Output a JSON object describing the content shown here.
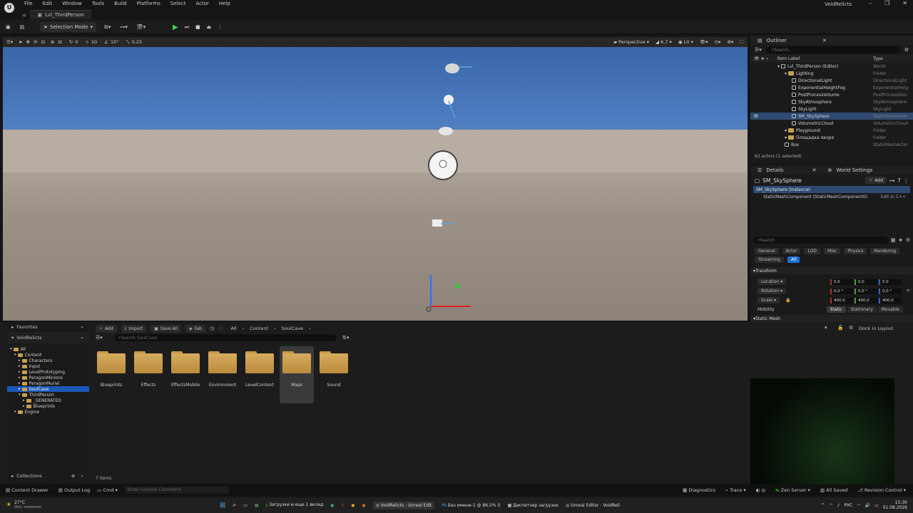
{
  "menubar": {
    "items": [
      "File",
      "Edit",
      "Window",
      "Tools",
      "Build",
      "Platforms",
      "Select",
      "Actor",
      "Help"
    ],
    "level_tab": "Lvl_ThirdPerson",
    "project": "VoidRelicts"
  },
  "toolbar": {
    "mode": "Selection Mode"
  },
  "viewport": {
    "perspective": "Perspective",
    "fov": "6,7",
    "lit": "Lit",
    "snap_grid": "10",
    "snap_rot": "10°",
    "snap_scale": "0,25",
    "cam_speed": "0"
  },
  "outliner": {
    "title": "Outliner",
    "search": "Search...",
    "col_label": "Item Label",
    "col_type": "Type",
    "rows": [
      {
        "label": "Lvl_ThirdPerson (Editor)",
        "type": "World",
        "indent": 0,
        "kind": "world"
      },
      {
        "label": "Lighting",
        "type": "Folder",
        "indent": 1,
        "kind": "folder"
      },
      {
        "label": "DirectionalLight",
        "type": "DirectionalLight",
        "indent": 2,
        "kind": "item"
      },
      {
        "label": "ExponentialHeightFog",
        "type": "ExponentialHeig",
        "indent": 2,
        "kind": "item"
      },
      {
        "label": "PostProcessVolume",
        "type": "PostProcessVolu",
        "indent": 2,
        "kind": "item"
      },
      {
        "label": "SkyAtmosphere",
        "type": "SkyAtmosphere",
        "indent": 2,
        "kind": "item"
      },
      {
        "label": "SkyLight",
        "type": "SkyLight",
        "indent": 2,
        "kind": "item"
      },
      {
        "label": "SM_SkySphere",
        "type": "StaticMeshActor",
        "indent": 2,
        "kind": "item",
        "selected": true
      },
      {
        "label": "VolumetricCloud",
        "type": "VolumetricCloud",
        "indent": 2,
        "kind": "item"
      },
      {
        "label": "Playground",
        "type": "Folder",
        "indent": 1,
        "kind": "folder"
      },
      {
        "label": "Площадка якоря",
        "type": "Folder",
        "indent": 1,
        "kind": "folder"
      },
      {
        "label": "Box",
        "type": "StaticMeshActor",
        "indent": 1,
        "kind": "item"
      }
    ],
    "count": "62 actors (1 selected)"
  },
  "details": {
    "tab1": "Details",
    "tab2": "World Settings",
    "actor": "SM_SkySphere",
    "add": "Add",
    "instance": "SM_SkySphere (Instance)",
    "component": "StaticMeshComponent (StaticMeshComponent0)",
    "edit_cpp": "Edit in C++",
    "search": "Search",
    "filters": [
      "General",
      "Actor",
      "LOD",
      "Misc",
      "Physics",
      "Rendering"
    ],
    "filters2": [
      "Streaming",
      "All"
    ],
    "transform": "Transform",
    "location": "Location",
    "rotation": "Rotation",
    "scale": "Scale",
    "mobility": "Mobility",
    "loc": [
      "0,0",
      "0,0",
      "0,0"
    ],
    "rot": [
      "0,0 °",
      "0,0 °",
      "0,0 °"
    ],
    "scl": [
      "400,0",
      "400,0",
      "400,0"
    ],
    "mob": [
      "Static",
      "Stationary",
      "Movable"
    ],
    "static_mesh": "Static Mesh"
  },
  "content": {
    "favorites": "Favorites",
    "project": "VoidRelicts",
    "add": "Add",
    "import": "Import",
    "save_all": "Save All",
    "fab": "Fab",
    "path": [
      "All",
      "Content",
      "SoulCave"
    ],
    "search": "Search SoulCave",
    "dock": "Dock in Layout",
    "tree": [
      {
        "label": "All",
        "lvl": 0
      },
      {
        "label": "Content",
        "lvl": 1
      },
      {
        "label": "Characters",
        "lvl": 2
      },
      {
        "label": "Input",
        "lvl": 2
      },
      {
        "label": "LevelPrototyping",
        "lvl": 2
      },
      {
        "label": "ParagonMinions",
        "lvl": 2
      },
      {
        "label": "ParagonMuriel",
        "lvl": 2
      },
      {
        "label": "SoulCave",
        "lvl": 2,
        "sel": true
      },
      {
        "label": "ThirdPerson",
        "lvl": 2
      },
      {
        "label": "_GENERATED",
        "lvl": 3
      },
      {
        "label": "Blueprints",
        "lvl": 3
      },
      {
        "label": "Engine",
        "lvl": 1
      }
    ],
    "folders": [
      "Blueprints",
      "Effects",
      "EffectsMobile",
      "Environment",
      "LevelContent",
      "Maps",
      "Sound"
    ],
    "items_count": "7 items",
    "collections": "Collections"
  },
  "statusbar": {
    "drawer": "Content Drawer",
    "output": "Output Log",
    "cmd": "Cmd",
    "console": "Enter Console Command",
    "diagnostics": "Diagnostics",
    "trace": "Trace",
    "zen": "Zen Server",
    "saved": "All Saved",
    "revision": "Revision Control"
  },
  "taskbar": {
    "weather": "27°C",
    "weather2": "Осн. солнечно",
    "app1": "Загрузки и еще 1 вклад",
    "app2": "VoidRelicts - Unreal Edit",
    "app3": "Без имени-1 @ 86,5% (I",
    "app4": "Диспетчер загрузок",
    "app5": "Unreal Editor - VoidReli",
    "lang": "РУС",
    "time": "15:30",
    "date": "01.08.2026"
  }
}
